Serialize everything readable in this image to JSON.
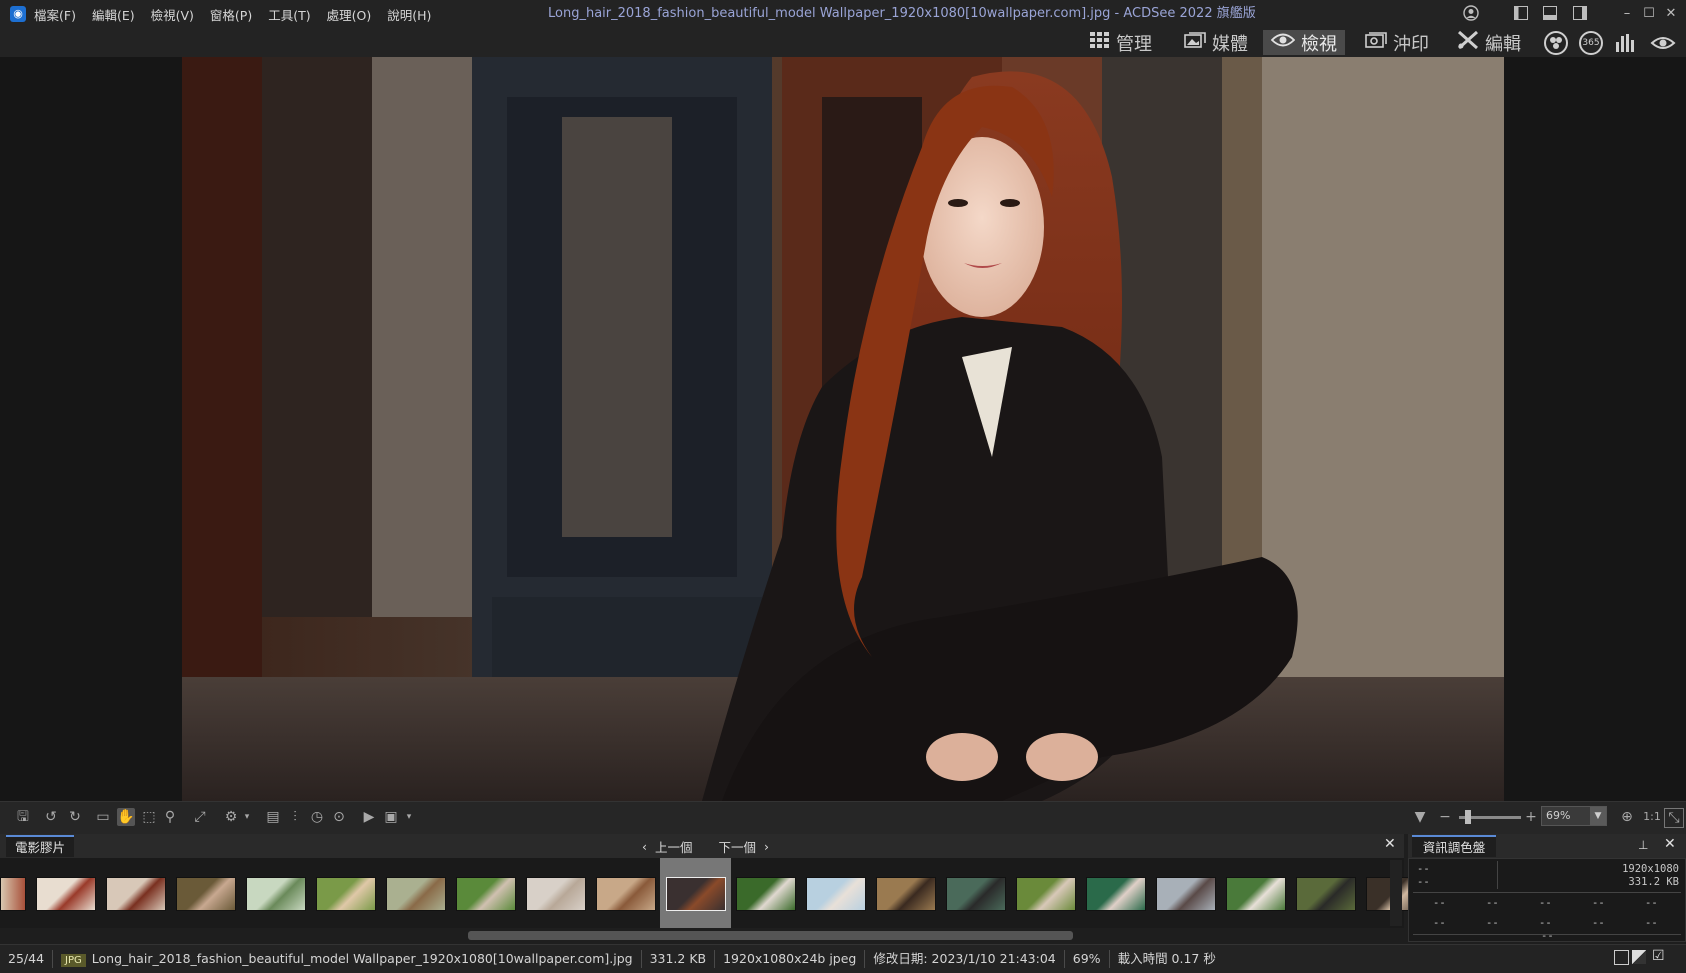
{
  "title_bar": {
    "app_icon": "camera-icon",
    "menus": [
      "檔案(F)",
      "編輯(E)",
      "檢視(V)",
      "窗格(P)",
      "工具(T)",
      "處理(O)",
      "說明(H)"
    ],
    "window_title": "Long_hair_2018_fashion_beautiful_model Wallpaper_1920x1080[10wallpaper.com].jpg - ACDSee 2022 旗艦版"
  },
  "mode_bar": {
    "modes": [
      {
        "label": "管理",
        "icon": "grid-icon"
      },
      {
        "label": "媒體",
        "icon": "media-icon"
      },
      {
        "label": "檢視",
        "icon": "eye-icon",
        "active": true
      },
      {
        "label": "沖印",
        "icon": "develop-icon"
      },
      {
        "label": "編輯",
        "icon": "edit-tools-icon"
      }
    ],
    "extra_labels": [
      "365"
    ]
  },
  "toolbar": {
    "zoom_value": "69%",
    "zoom_fraction": 0.69,
    "one_to_one": "1:1"
  },
  "filmstrip": {
    "tab_label": "電影膠片",
    "prev_label": "上一個",
    "next_label": "下一個",
    "thumbnail_count": 20,
    "selected_index": 9
  },
  "info_palette": {
    "tab_label": "資訊調色盤",
    "dimensions": "1920x1080",
    "size": "331.2 KB",
    "placeholder": "--"
  },
  "status_bar": {
    "position": "25/44",
    "type_badge": "JPG",
    "filename": "Long_hair_2018_fashion_beautiful_model Wallpaper_1920x1080[10wallpaper.com].jpg",
    "file_size": "331.2 KB",
    "image_info": "1920x1080x24b jpeg",
    "modified": "修改日期: 2023/1/10 21:43:04",
    "zoom": "69%",
    "load_time": "載入時間 0.17 秒"
  },
  "colors": {
    "accent": "#5a8ad6",
    "title_text": "#9aa4d6",
    "background": "#1e1e1e"
  }
}
